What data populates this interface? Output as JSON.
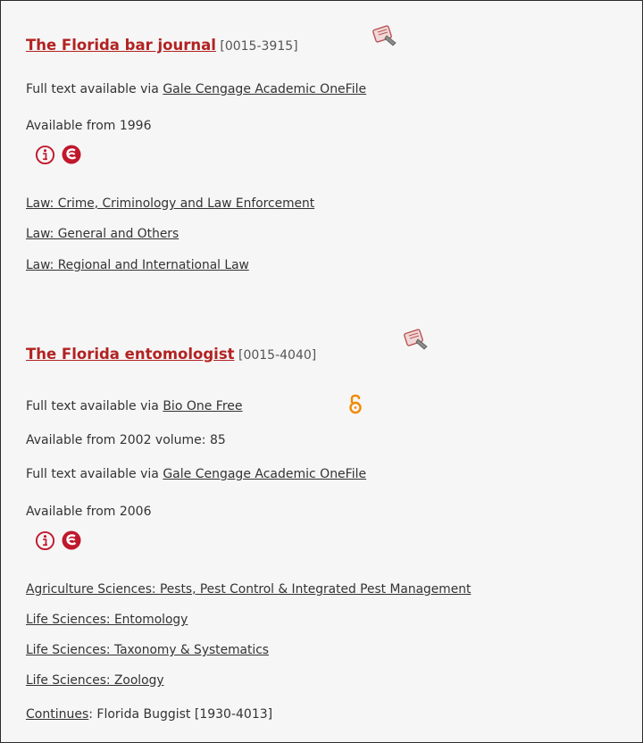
{
  "records": [
    {
      "title": "The Florida bar journal",
      "issn": "[0015-3915]",
      "full_text": [
        {
          "prefix": "Full text available via",
          "provider": "Gale Cengage Academic OneFile",
          "availability": "Available from 1996",
          "open_access": false
        }
      ],
      "icons": [
        "info-icon",
        "sfx-icon"
      ],
      "subjects": [
        "Law: Crime, Criminology and Law Enforcement",
        "Law: General and Others",
        "Law: Regional and International Law"
      ]
    },
    {
      "title": "The Florida entomologist",
      "issn": "[0015-4040]",
      "full_text": [
        {
          "prefix": "Full text available via",
          "provider": "Bio One Free",
          "availability": "Available from 2002 volume: 85",
          "open_access": true
        },
        {
          "prefix": "Full text available via",
          "provider": "Gale Cengage Academic OneFile",
          "availability": "Available from 2006",
          "open_access": false
        }
      ],
      "icons": [
        "info-icon",
        "sfx-icon"
      ],
      "subjects": [
        "Agriculture Sciences: Pests, Pest Control & Integrated Pest Management",
        "Life Sciences: Entomology",
        "Life Sciences: Taxonomy & Systematics",
        "Life Sciences: Zoology"
      ],
      "continues": {
        "label": "Continues",
        "text": ": Florida Buggist [1930-4013]"
      }
    }
  ],
  "colors": {
    "title": "#b22222",
    "icon_red": "#c0182c",
    "open_access": "#f08a00"
  }
}
